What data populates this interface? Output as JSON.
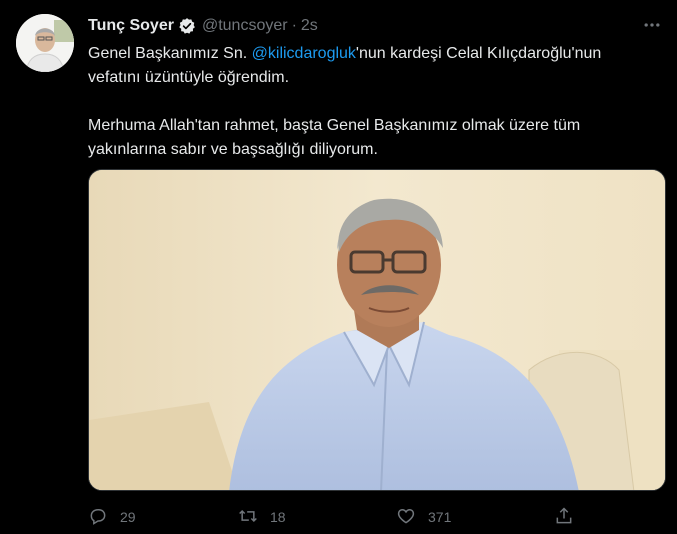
{
  "tweet": {
    "author_name": "Tunç Soyer",
    "handle": "@tuncsoyer",
    "separator": "·",
    "time": "2s",
    "text_line1_pre": "Genel Başkanımız Sn. ",
    "mention": "@kilicdarogluk",
    "text_line1_post": "'nun kardeşi Celal Kılıçdaroğlu'nun vefatını üzüntüyle öğrendim.",
    "text_paragraph2": "Merhuma Allah'tan rahmet, başta Genel Başkanımız olmak üzere tüm yakınlarına sabır ve başsağlığı diliyorum."
  },
  "actions": {
    "reply_count": "29",
    "retweet_count": "18",
    "like_count": "371"
  },
  "icons": {
    "verified": "verified-badge-icon",
    "more": "more-icon",
    "reply": "reply-icon",
    "retweet": "retweet-icon",
    "like": "heart-icon",
    "share": "share-icon"
  },
  "colors": {
    "background": "#000000",
    "text": "#e7e9ea",
    "muted": "#71767b",
    "accent": "#1d9bf0"
  }
}
